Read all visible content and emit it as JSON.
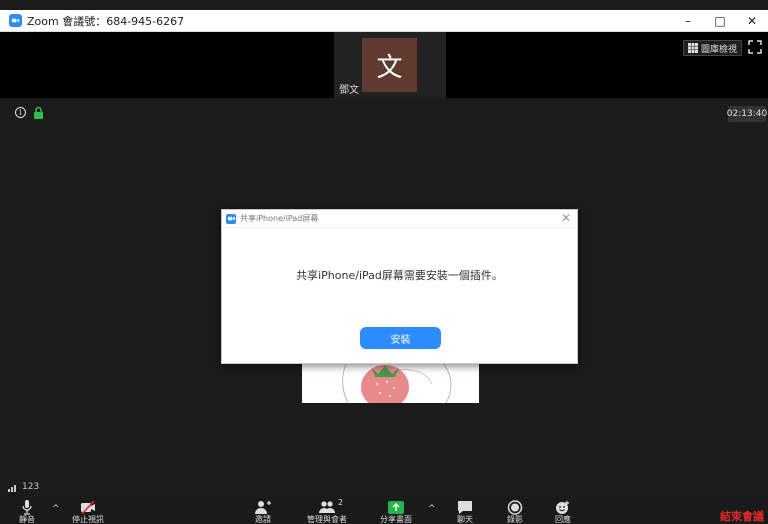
{
  "window": {
    "title": "Zoom 會議號：684-945-6267",
    "minimize_glyph": "–",
    "maximize_glyph": "□",
    "close_glyph": "✕"
  },
  "participant_strip": {
    "participant": {
      "avatar_text": "文",
      "name": "鄧文"
    },
    "gallery_view_label": "圖庫檢視"
  },
  "main_view": {
    "info_icon_glyph": "i",
    "timer": "02:13:40",
    "network": "123"
  },
  "dialog": {
    "title": "共享iPhone/iPad屏幕",
    "message": "共享iPhone/iPad屏幕需要安裝一個插件。",
    "install_button": "安裝",
    "close_glyph": "✕"
  },
  "toolbar": {
    "mute": "靜音",
    "stop_video": "停止視訊",
    "invite": "邀請",
    "manage_participants": "管理與會者",
    "participant_count": "2",
    "share_screen": "分享畫面",
    "chat": "聊天",
    "record": "錄影",
    "reactions": "回應",
    "end_meeting": "結束會議",
    "caret_glyph": "^"
  },
  "colors": {
    "accent": "#2D8CFF",
    "end": "#E02828",
    "share": "#23B54C",
    "lock": "#2DBE4E"
  }
}
